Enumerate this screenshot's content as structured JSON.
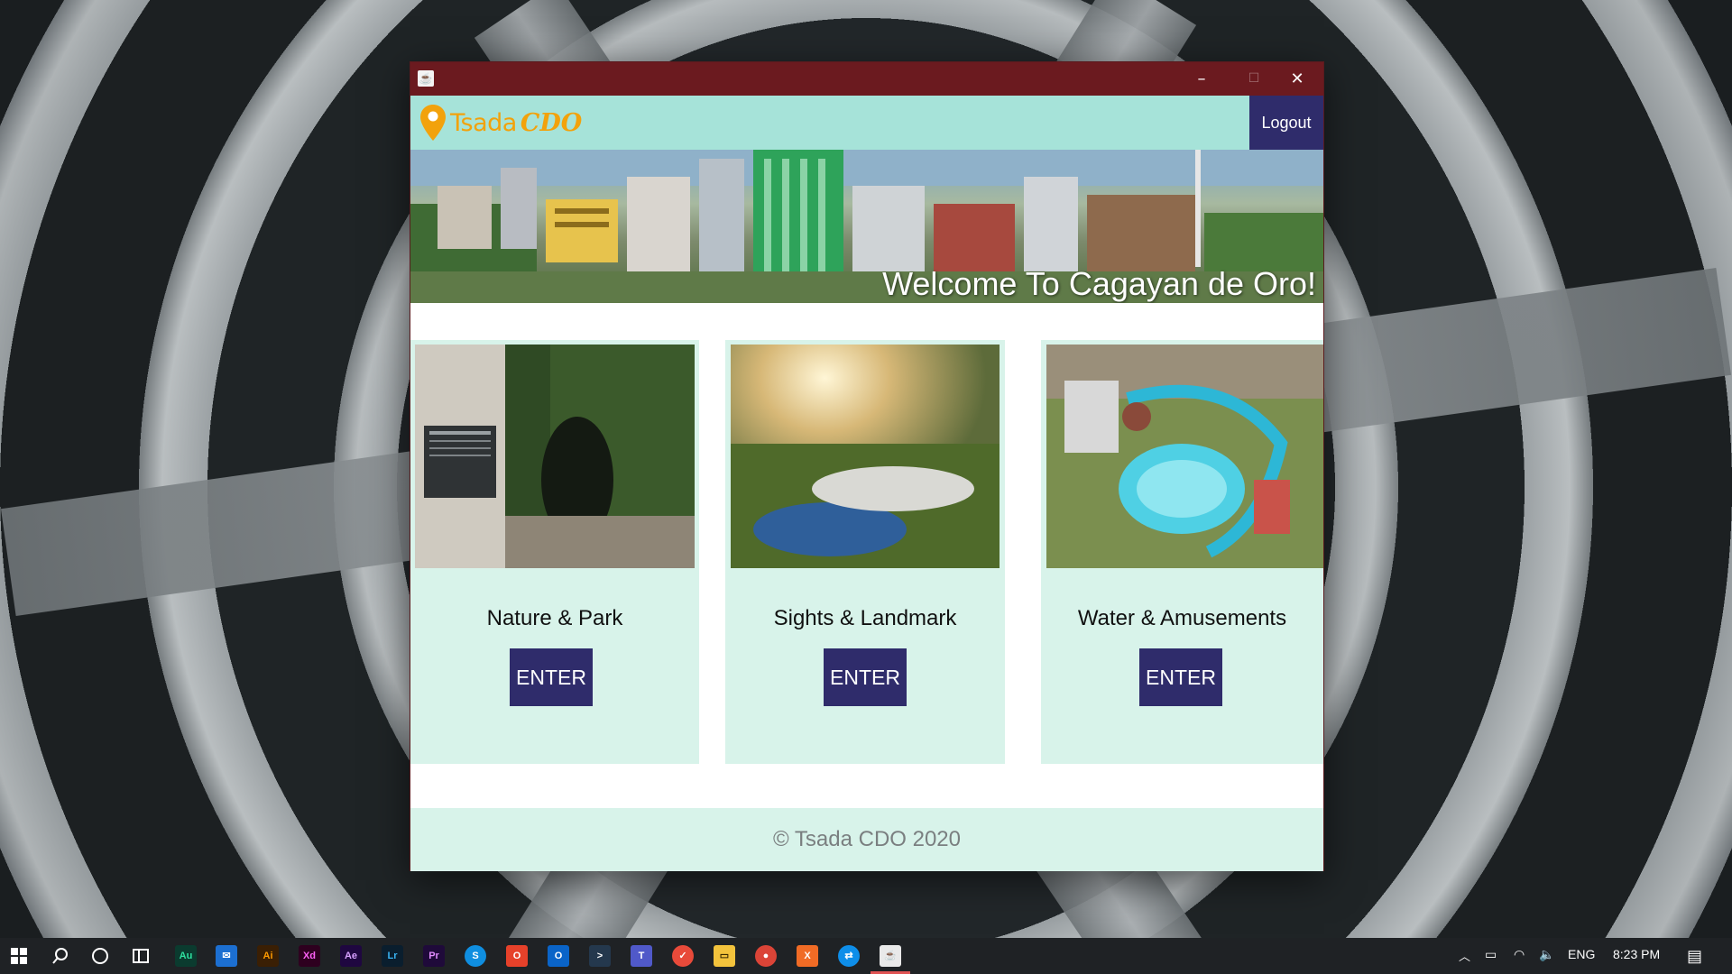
{
  "header": {
    "logo_text": "Tsada",
    "logo_accent": "CDO",
    "logout_label": "Logout"
  },
  "banner": {
    "title": "Welcome To Cagayan de Oro!"
  },
  "categories": [
    {
      "title": "Nature & Park",
      "button": "ENTER"
    },
    {
      "title": "Sights & Landmark",
      "button": "ENTER"
    },
    {
      "title": "Water & Amusements",
      "button": "ENTER"
    }
  ],
  "footer": {
    "text": "© Tsada CDO 2020"
  },
  "taskbar": {
    "language": "ENG",
    "time": "8:23 PM",
    "pinned": [
      "start",
      "search",
      "cortana",
      "task-view",
      "audition",
      "mail",
      "illustrator",
      "xd",
      "after-effects",
      "lightroom",
      "premiere",
      "skype",
      "office",
      "outlook",
      "powershell",
      "teams",
      "snip",
      "file-explorer",
      "chrome",
      "xampp",
      "teamviewer",
      "java"
    ]
  },
  "colors": {
    "titlebar": "#6b1a1f",
    "header": "#a6e3d9",
    "accent_dark": "#2f2c6b",
    "card_bg": "#d8f3ea",
    "logo": "#f2a20c"
  }
}
